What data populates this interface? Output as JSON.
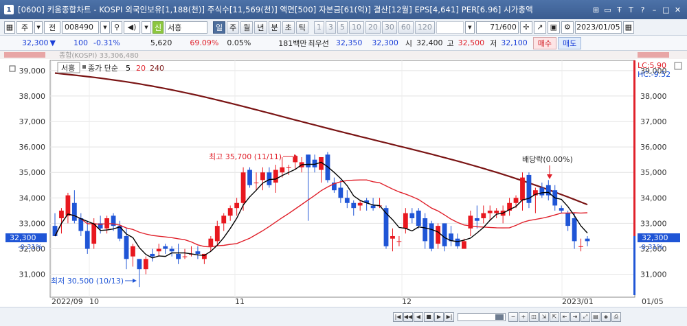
{
  "window": {
    "code": "1",
    "title": "[0600] 키움종합차트 - KOSPI 외국인보유[1,188(천)] 주식수[11,569(천)] 액면[500] 자본금[61(억)] 결산[12월] EPS[4,641] PER[6.96] 시가총액"
  },
  "toolbar": {
    "stock_code": "008490",
    "stock_name": "서흥",
    "credit_badge": "신",
    "period_buttons": [
      "일",
      "주",
      "월",
      "년",
      "분",
      "초",
      "틱"
    ],
    "active_period": "일",
    "interval_buttons": [
      "1",
      "3",
      "5",
      "10",
      "20",
      "30",
      "60",
      "120"
    ],
    "count": "71",
    "count_total": "/600",
    "date": "2023/01/05",
    "type_label": "주",
    "prev_label": "전"
  },
  "quote": {
    "price": "32,300",
    "change": "100",
    "change_pct": "-0.31%",
    "volume": "5,620",
    "volume_ratio": "69.09%",
    "turnover": "0.05%",
    "amount": "181백만",
    "best_ask_label": "최우선",
    "best_ask": "32,350",
    "best_bid": "32,300",
    "open_label": "시",
    "open": "32,400",
    "high_label": "고",
    "high": "32,500",
    "low_label": "저",
    "low": "32,100",
    "buy_label": "매수",
    "sell_label": "매도"
  },
  "chart": {
    "legend_name": "서흥",
    "legend_type": "종가 단순",
    "ma_periods": [
      "5",
      "20",
      "240"
    ],
    "top_overlay": "종합(KOSPI) 33,306,480",
    "lc_label": "LC:5.90",
    "hc_label": "HC:-9.52",
    "current_price_tag": "32,300",
    "current_pct_tag": "-0.31%",
    "high_annotation": "최고 35,700 (11/11)",
    "low_annotation": "최저 30,500 (10/13)",
    "dividend_annotation": "배당락(0.00%)",
    "x_labels": [
      "2022/09",
      "10",
      "11",
      "12",
      "2023/01"
    ],
    "right_date_label": "01/05",
    "colors": {
      "up": "#e8181f",
      "down": "#1f55d6",
      "ma5": "#000000",
      "ma20": "#e0202a",
      "ma240": "#7a1414"
    }
  },
  "chart_data": {
    "type": "candlestick",
    "y_ticks": [
      31000,
      32000,
      33000,
      34000,
      35000,
      36000,
      37000,
      38000,
      39000
    ],
    "ylim": [
      30100,
      39400
    ],
    "candles": [
      [
        32900,
        33400,
        32500,
        32500
      ],
      [
        33200,
        33600,
        32600,
        33500
      ],
      [
        33300,
        34200,
        33000,
        34100
      ],
      [
        33800,
        34300,
        33000,
        33100
      ],
      [
        33200,
        33400,
        32500,
        32700
      ],
      [
        32700,
        33100,
        31800,
        32000
      ],
      [
        32200,
        33200,
        32000,
        33000
      ],
      [
        33000,
        33300,
        32600,
        32800
      ],
      [
        32800,
        33300,
        32600,
        33200
      ],
      [
        33300,
        33400,
        32700,
        32900
      ],
      [
        32900,
        33100,
        32300,
        32400
      ],
      [
        32500,
        32800,
        31200,
        31600
      ],
      [
        31700,
        32200,
        31300,
        32100
      ],
      [
        31600,
        31600,
        30500,
        31200
      ],
      [
        31200,
        31700,
        31000,
        31600
      ],
      [
        31800,
        32000,
        31500,
        31700
      ],
      [
        31900,
        32200,
        31700,
        32000
      ],
      [
        32100,
        32200,
        31800,
        32000
      ],
      [
        32000,
        32100,
        31700,
        31900
      ],
      [
        31800,
        32200,
        31400,
        31600
      ],
      [
        31700,
        32000,
        31600,
        31700
      ],
      [
        31800,
        32100,
        31700,
        31800
      ],
      [
        31900,
        32100,
        31600,
        31800
      ],
      [
        31600,
        31800,
        31400,
        31800
      ],
      [
        32100,
        32500,
        31900,
        32400
      ],
      [
        32300,
        33100,
        32100,
        32900
      ],
      [
        33000,
        33400,
        32700,
        33300
      ],
      [
        33300,
        33700,
        33100,
        33600
      ],
      [
        33600,
        34000,
        33300,
        33800
      ],
      [
        33800,
        35200,
        33500,
        35000
      ],
      [
        35100,
        35200,
        34400,
        34500
      ],
      [
        34600,
        35000,
        34300,
        34600
      ],
      [
        34700,
        35200,
        34300,
        35000
      ],
      [
        35000,
        35200,
        34400,
        34500
      ],
      [
        34600,
        35300,
        34200,
        35100
      ],
      [
        35000,
        35600,
        34800,
        35200
      ],
      [
        35200,
        35300,
        34900,
        35200
      ],
      [
        35400,
        35700,
        35100,
        35600
      ],
      [
        35200,
        35600,
        35000,
        35400
      ],
      [
        35700,
        35700,
        33100,
        35200
      ],
      [
        35500,
        35700,
        35000,
        35200
      ],
      [
        35100,
        35600,
        34600,
        35600
      ],
      [
        35700,
        35800,
        34600,
        34700
      ],
      [
        34600,
        34800,
        34200,
        34300
      ],
      [
        34400,
        34700,
        33800,
        34000
      ],
      [
        34000,
        34300,
        33600,
        33800
      ],
      [
        33800,
        33900,
        33300,
        33600
      ],
      [
        33700,
        33900,
        33500,
        33800
      ],
      [
        33900,
        34000,
        33500,
        33800
      ],
      [
        33700,
        34000,
        33500,
        33600
      ],
      [
        33700,
        34000,
        33600,
        33700
      ],
      [
        33600,
        33700,
        32000,
        32100
      ],
      [
        32400,
        32800,
        31900,
        32500
      ],
      [
        32300,
        32500,
        32100,
        32300
      ],
      [
        32800,
        33600,
        32600,
        33400
      ],
      [
        33400,
        33600,
        33000,
        33200
      ],
      [
        33500,
        33600,
        32800,
        32900
      ],
      [
        33200,
        33400,
        32000,
        32300
      ],
      [
        33000,
        33100,
        31900,
        32000
      ],
      [
        32200,
        33000,
        32000,
        32900
      ],
      [
        33000,
        33000,
        31900,
        32100
      ],
      [
        32600,
        32900,
        32100,
        32300
      ],
      [
        32400,
        32600,
        32000,
        32100
      ],
      [
        32000,
        32400,
        32000,
        32300
      ],
      [
        32800,
        33500,
        32500,
        33300
      ],
      [
        33200,
        33700,
        32800,
        33100
      ],
      [
        33200,
        33700,
        33000,
        33400
      ],
      [
        33400,
        33700,
        33100,
        33500
      ],
      [
        33400,
        33600,
        33200,
        33500
      ],
      [
        33300,
        33700,
        33000,
        33500
      ],
      [
        33500,
        34000,
        33300,
        33800
      ],
      [
        33800,
        34100,
        33600,
        34000
      ],
      [
        33900,
        35000,
        33500,
        34800
      ],
      [
        34900,
        35000,
        33600,
        33800
      ],
      [
        34100,
        34400,
        33400,
        34300
      ],
      [
        34400,
        34600,
        34000,
        34100
      ],
      [
        34500,
        34700,
        33900,
        34100
      ],
      [
        34300,
        34500,
        33500,
        33700
      ],
      [
        33600,
        33700,
        33400,
        33500
      ],
      [
        33400,
        33500,
        32700,
        32900
      ],
      [
        33200,
        33400,
        32000,
        32300
      ],
      [
        32100,
        32400,
        31900,
        32100
      ],
      [
        32400,
        32500,
        32100,
        32300
      ]
    ],
    "ma240_endpoints": [
      38900,
      33700
    ]
  }
}
